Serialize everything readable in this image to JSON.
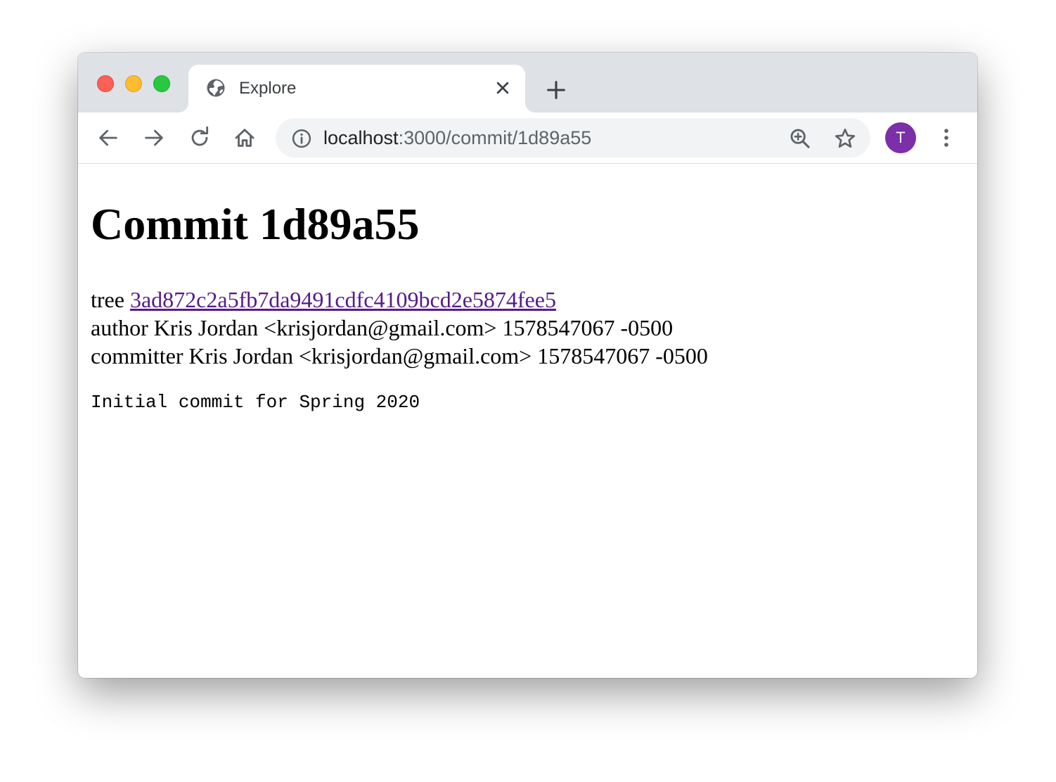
{
  "window": {
    "controls": {
      "close": "close-window",
      "minimize": "minimize-window",
      "zoom": "zoom-window"
    }
  },
  "tab": {
    "title": "Explore",
    "favicon": "globe-icon",
    "close_icon": "close-icon"
  },
  "new_tab_icon": "plus-icon",
  "toolbar": {
    "back_icon": "arrow-left-icon",
    "forward_icon": "arrow-right-icon",
    "reload_icon": "reload-icon",
    "home_icon": "home-icon",
    "url_host": "localhost",
    "url_rest": ":3000/commit/1d89a55",
    "site_info_icon": "info-icon",
    "zoom_icon": "zoom-in-icon",
    "bookmark_icon": "star-icon",
    "profile_initial": "T",
    "menu_icon": "kebab-menu-icon"
  },
  "page": {
    "heading": "Commit 1d89a55",
    "tree_label": "tree",
    "tree_hash": "3ad872c2a5fb7da9491cdfc4109bcd2e5874fee5",
    "author_line": "author Kris Jordan <krisjordan@gmail.com> 1578547067 -0500",
    "committer_line": "committer Kris Jordan <krisjordan@gmail.com> 1578547067 -0500",
    "message": "Initial commit for Spring 2020"
  },
  "colors": {
    "titlebar": "#dee1e6",
    "avatar": "#7b2fa8",
    "visited_link": "#551a8b"
  }
}
